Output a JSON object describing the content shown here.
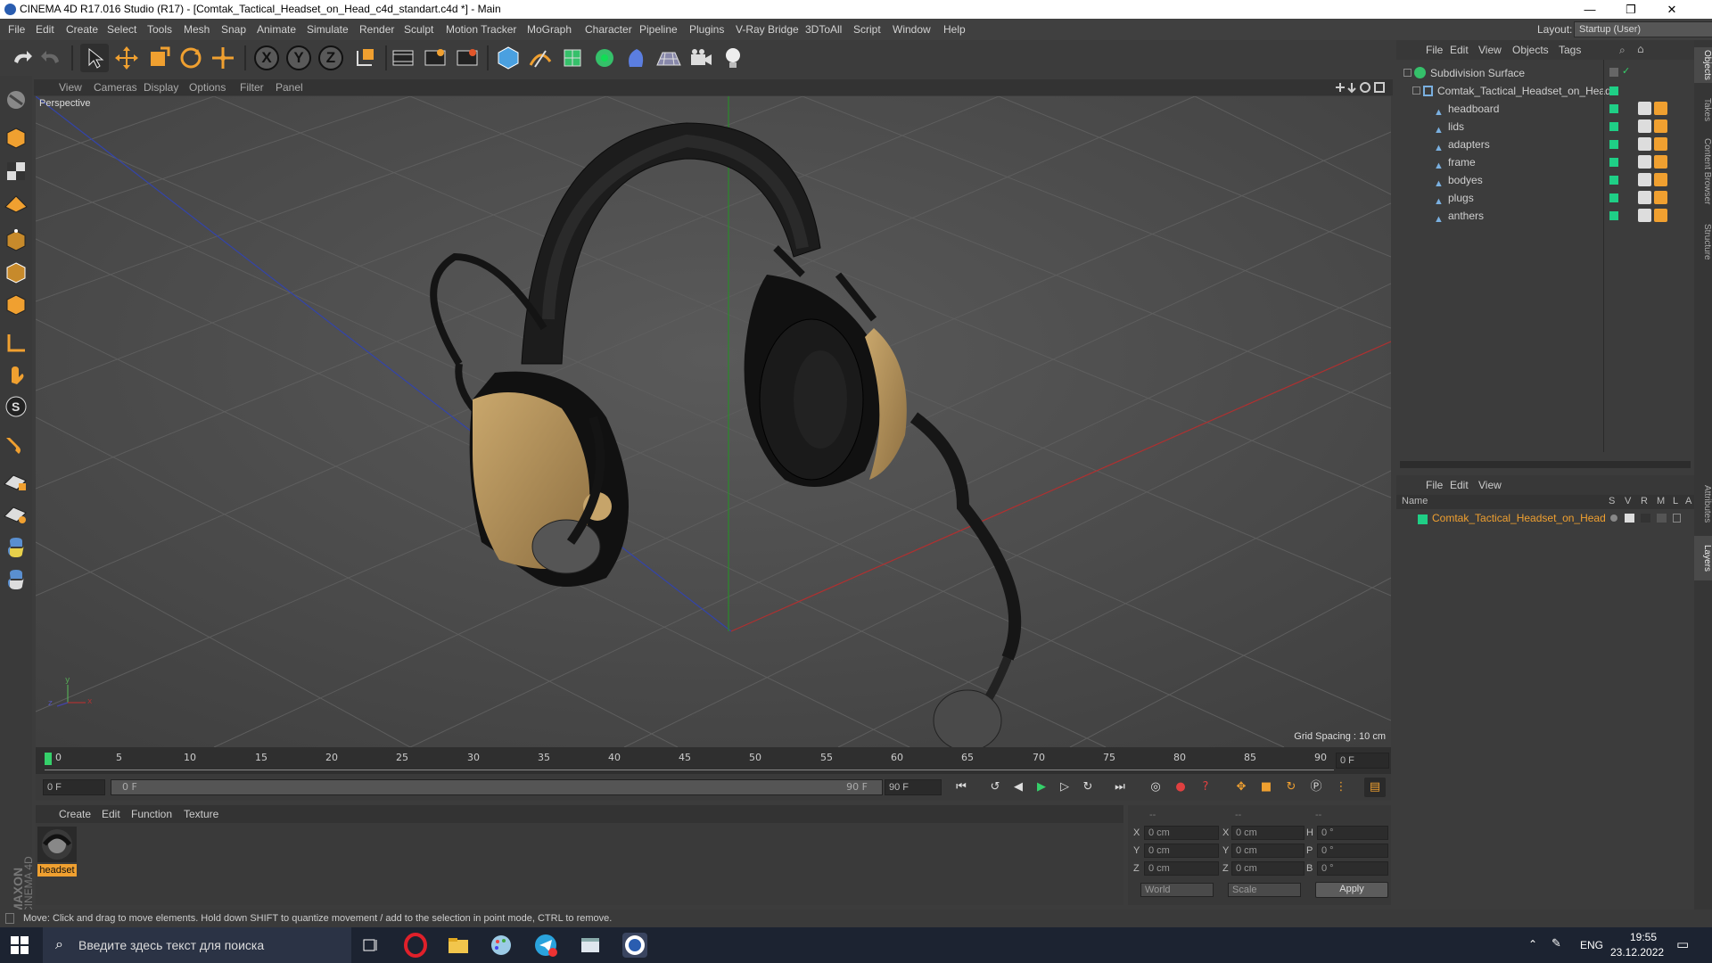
{
  "window": {
    "title": "CINEMA 4D R17.016 Studio (R17) - [Comtak_Tactical_Headset_on_Head_c4d_standart.c4d *] - Main",
    "controls": {
      "minimize": "—",
      "restore": "❐",
      "close": "✕"
    }
  },
  "menubar": {
    "items": [
      "File",
      "Edit",
      "Create",
      "Select",
      "Tools",
      "Mesh",
      "Snap",
      "Animate",
      "Simulate",
      "Render",
      "Sculpt",
      "Motion Tracker",
      "MoGraph",
      "Character",
      "Pipeline",
      "Plugins",
      "V-Ray Bridge",
      "3DToAll",
      "Script",
      "Window",
      "Help"
    ],
    "layout_label": "Layout:",
    "layout_value": "Startup (User)"
  },
  "toolbar": {
    "axis_x": "X",
    "axis_y": "Y",
    "axis_z": "Z"
  },
  "viewport": {
    "menu": [
      "View",
      "Cameras",
      "Display",
      "Options",
      "Filter",
      "Panel"
    ],
    "camera_label": "Perspective",
    "grid_spacing": "Grid Spacing : 10 cm",
    "axis_x": "x",
    "axis_y": "y",
    "axis_z": "z"
  },
  "timeline": {
    "ticks": [
      "0",
      "5",
      "10",
      "15",
      "20",
      "25",
      "30",
      "35",
      "40",
      "45",
      "50",
      "55",
      "60",
      "65",
      "70",
      "75",
      "80",
      "85",
      "90"
    ],
    "current_frame": "0 F",
    "start_field": "0 F",
    "range_start": "0 F",
    "range_end": "90 F",
    "end_field": "90 F"
  },
  "materials": {
    "menu": [
      "Create",
      "Edit",
      "Function",
      "Texture"
    ],
    "items": [
      {
        "name": "headset"
      }
    ]
  },
  "coordinates": {
    "header": [
      "--",
      "--",
      "--"
    ],
    "rows": [
      {
        "l1": "X",
        "v1": "0 cm",
        "l2": "X",
        "v2": "0 cm",
        "l3": "H",
        "v3": "0 °"
      },
      {
        "l1": "Y",
        "v1": "0 cm",
        "l2": "Y",
        "v2": "0 cm",
        "l3": "P",
        "v3": "0 °"
      },
      {
        "l1": "Z",
        "v1": "0 cm",
        "l2": "Z",
        "v2": "0 cm",
        "l3": "B",
        "v3": "0 °"
      }
    ],
    "world": "World",
    "scale": "Scale",
    "apply": "Apply"
  },
  "object_manager": {
    "menu": [
      "File",
      "Edit",
      "View",
      "Objects",
      "Tags"
    ],
    "objects": [
      {
        "name": "Subdivision Surface",
        "level": 0
      },
      {
        "name": "Comtak_Tactical_Headset_on_Head",
        "level": 1
      },
      {
        "name": "headboard",
        "level": 2
      },
      {
        "name": "lids",
        "level": 2
      },
      {
        "name": "adapters",
        "level": 2
      },
      {
        "name": "frame",
        "level": 2
      },
      {
        "name": "bodyes",
        "level": 2
      },
      {
        "name": "plugs",
        "level": 2
      },
      {
        "name": "anthers",
        "level": 2
      }
    ]
  },
  "layer_manager": {
    "menu": [
      "File",
      "Edit",
      "View"
    ],
    "columns": [
      "Name",
      "S",
      "V",
      "R",
      "M",
      "L",
      "A"
    ],
    "layers": [
      {
        "name": "Comtak_Tactical_Headset_on_Head",
        "color": "#1fcf86"
      }
    ]
  },
  "right_tabs": [
    "Objects",
    "Takes",
    "Content Browser",
    "Structure",
    "Attributes",
    "Layers"
  ],
  "statusbar": {
    "text": "Move: Click and drag to move elements. Hold down SHIFT to quantize movement / add to the selection in point mode, CTRL to remove."
  },
  "brand": {
    "maxon": "MAXON",
    "cinema": "CINEMA 4D"
  },
  "taskbar": {
    "search_placeholder": "Введите здесь текст для поиска",
    "lang": "ENG",
    "time": "19:55",
    "date": "23.12.2022"
  },
  "colors": {
    "accent_orange": "#f0a030",
    "visible_green": "#1fcf86",
    "tan": "#c7a36a"
  }
}
